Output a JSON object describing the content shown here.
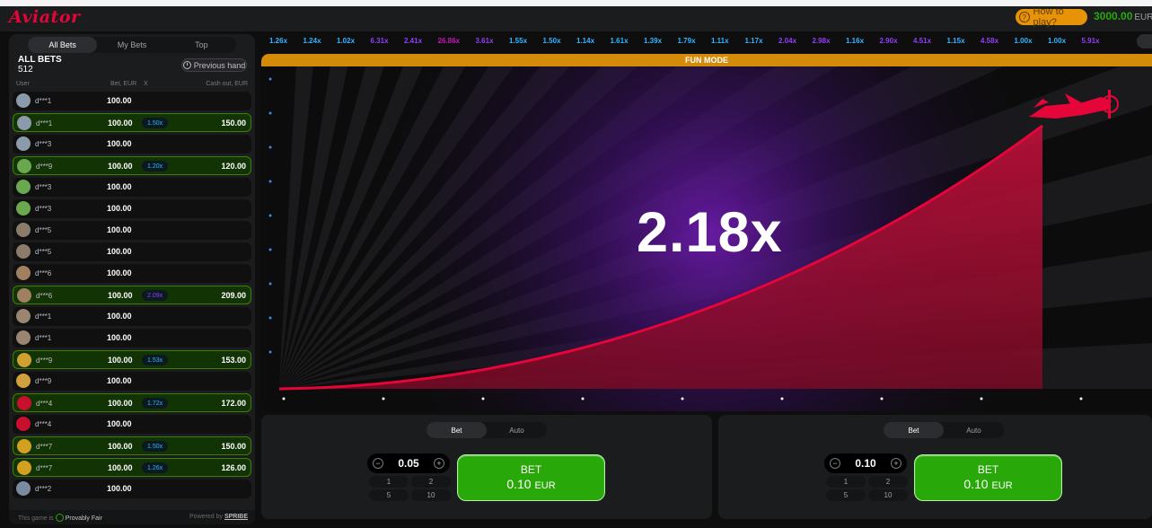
{
  "app": {
    "logo": "Aviator",
    "how_to_play": "How to play?",
    "balance": "3000.00",
    "currency": "EUR"
  },
  "left_panel": {
    "tabs": [
      "All Bets",
      "My Bets",
      "Top"
    ],
    "title": "ALL BETS",
    "count": "512",
    "previous_hand": "Previous hand",
    "columns": {
      "user": "User",
      "bet": "Bet, EUR",
      "x": "X",
      "cashout": "Cash out, EUR"
    },
    "rows": [
      {
        "user": "d***1",
        "bet": "100.00",
        "coef": "",
        "cashout": "",
        "win": false,
        "avatar_color": "#8b9bab"
      },
      {
        "user": "d***1",
        "bet": "100.00",
        "coef": "1.50x",
        "cashout": "150.00",
        "win": true,
        "coef_color": "blue",
        "avatar_color": "#8b9bab"
      },
      {
        "user": "d***3",
        "bet": "100.00",
        "coef": "",
        "cashout": "",
        "win": false,
        "avatar_color": "#8b9bab"
      },
      {
        "user": "d***9",
        "bet": "100.00",
        "coef": "1.20x",
        "cashout": "120.00",
        "win": true,
        "coef_color": "blue",
        "avatar_color": "#6aa84f"
      },
      {
        "user": "d***3",
        "bet": "100.00",
        "coef": "",
        "cashout": "",
        "win": false,
        "avatar_color": "#6aa84f"
      },
      {
        "user": "d***3",
        "bet": "100.00",
        "coef": "",
        "cashout": "",
        "win": false,
        "avatar_color": "#6aa84f"
      },
      {
        "user": "d***5",
        "bet": "100.00",
        "coef": "",
        "cashout": "",
        "win": false,
        "avatar_color": "#8c7b6b"
      },
      {
        "user": "d***5",
        "bet": "100.00",
        "coef": "",
        "cashout": "",
        "win": false,
        "avatar_color": "#8c7b6b"
      },
      {
        "user": "d***6",
        "bet": "100.00",
        "coef": "",
        "cashout": "",
        "win": false,
        "avatar_color": "#a08060"
      },
      {
        "user": "d***6",
        "bet": "100.00",
        "coef": "2.09x",
        "cashout": "209.00",
        "win": true,
        "coef_color": "purple",
        "avatar_color": "#a08060"
      },
      {
        "user": "d***1",
        "bet": "100.00",
        "coef": "",
        "cashout": "",
        "win": false,
        "avatar_color": "#9a8570"
      },
      {
        "user": "d***1",
        "bet": "100.00",
        "coef": "",
        "cashout": "",
        "win": false,
        "avatar_color": "#9a8570"
      },
      {
        "user": "d***9",
        "bet": "100.00",
        "coef": "1.53x",
        "cashout": "153.00",
        "win": true,
        "coef_color": "blue",
        "avatar_color": "#d0a030"
      },
      {
        "user": "d***9",
        "bet": "100.00",
        "coef": "",
        "cashout": "",
        "win": false,
        "avatar_color": "#d0a040"
      },
      {
        "user": "d***4",
        "bet": "100.00",
        "coef": "1.72x",
        "cashout": "172.00",
        "win": true,
        "coef_color": "blue",
        "avatar_color": "#c8102e"
      },
      {
        "user": "d***4",
        "bet": "100.00",
        "coef": "",
        "cashout": "",
        "win": false,
        "avatar_color": "#c8102e"
      },
      {
        "user": "d***7",
        "bet": "100.00",
        "coef": "1.50x",
        "cashout": "150.00",
        "win": true,
        "coef_color": "blue",
        "avatar_color": "#d4a020"
      },
      {
        "user": "d***7",
        "bet": "100.00",
        "coef": "1.26x",
        "cashout": "126.00",
        "win": true,
        "coef_color": "blue",
        "avatar_color": "#d4a020"
      },
      {
        "user": "d***2",
        "bet": "100.00",
        "coef": "",
        "cashout": "",
        "win": false,
        "avatar_color": "#7a8aa0"
      }
    ],
    "footer_fair": "This game is",
    "footer_fair_link": "Provably Fair",
    "footer_powered": "Powered by",
    "footer_brand": "SPRIBE"
  },
  "history": [
    {
      "v": "1.26x",
      "c": "#34b4ff"
    },
    {
      "v": "1.24x",
      "c": "#34b4ff"
    },
    {
      "v": "1.02x",
      "c": "#34b4ff"
    },
    {
      "v": "6.31x",
      "c": "#913ef8"
    },
    {
      "v": "2.41x",
      "c": "#913ef8"
    },
    {
      "v": "26.86x",
      "c": "#c017b4"
    },
    {
      "v": "3.61x",
      "c": "#913ef8"
    },
    {
      "v": "1.55x",
      "c": "#34b4ff"
    },
    {
      "v": "1.50x",
      "c": "#34b4ff"
    },
    {
      "v": "1.14x",
      "c": "#34b4ff"
    },
    {
      "v": "1.61x",
      "c": "#34b4ff"
    },
    {
      "v": "1.39x",
      "c": "#34b4ff"
    },
    {
      "v": "1.79x",
      "c": "#34b4ff"
    },
    {
      "v": "1.11x",
      "c": "#34b4ff"
    },
    {
      "v": "1.17x",
      "c": "#34b4ff"
    },
    {
      "v": "2.04x",
      "c": "#913ef8"
    },
    {
      "v": "2.98x",
      "c": "#913ef8"
    },
    {
      "v": "1.16x",
      "c": "#34b4ff"
    },
    {
      "v": "2.90x",
      "c": "#913ef8"
    },
    {
      "v": "4.51x",
      "c": "#913ef8"
    },
    {
      "v": "1.15x",
      "c": "#34b4ff"
    },
    {
      "v": "4.58x",
      "c": "#913ef8"
    },
    {
      "v": "1.00x",
      "c": "#34b4ff"
    },
    {
      "v": "1.00x",
      "c": "#34b4ff"
    },
    {
      "v": "5.91x",
      "c": "#913ef8"
    }
  ],
  "game": {
    "fun_mode": "FUN MODE",
    "multiplier": "2.18x"
  },
  "bet_panels": [
    {
      "tab_bet": "Bet",
      "tab_auto": "Auto",
      "amount": "0.05",
      "quick": [
        "1",
        "2",
        "5",
        "10"
      ],
      "button_label": "BET",
      "button_amount": "0.10",
      "button_currency": "EUR"
    },
    {
      "tab_bet": "Bet",
      "tab_auto": "Auto",
      "amount": "0.10",
      "quick": [
        "1",
        "2",
        "5",
        "10"
      ],
      "button_label": "BET",
      "button_amount": "0.10",
      "button_currency": "EUR"
    }
  ]
}
